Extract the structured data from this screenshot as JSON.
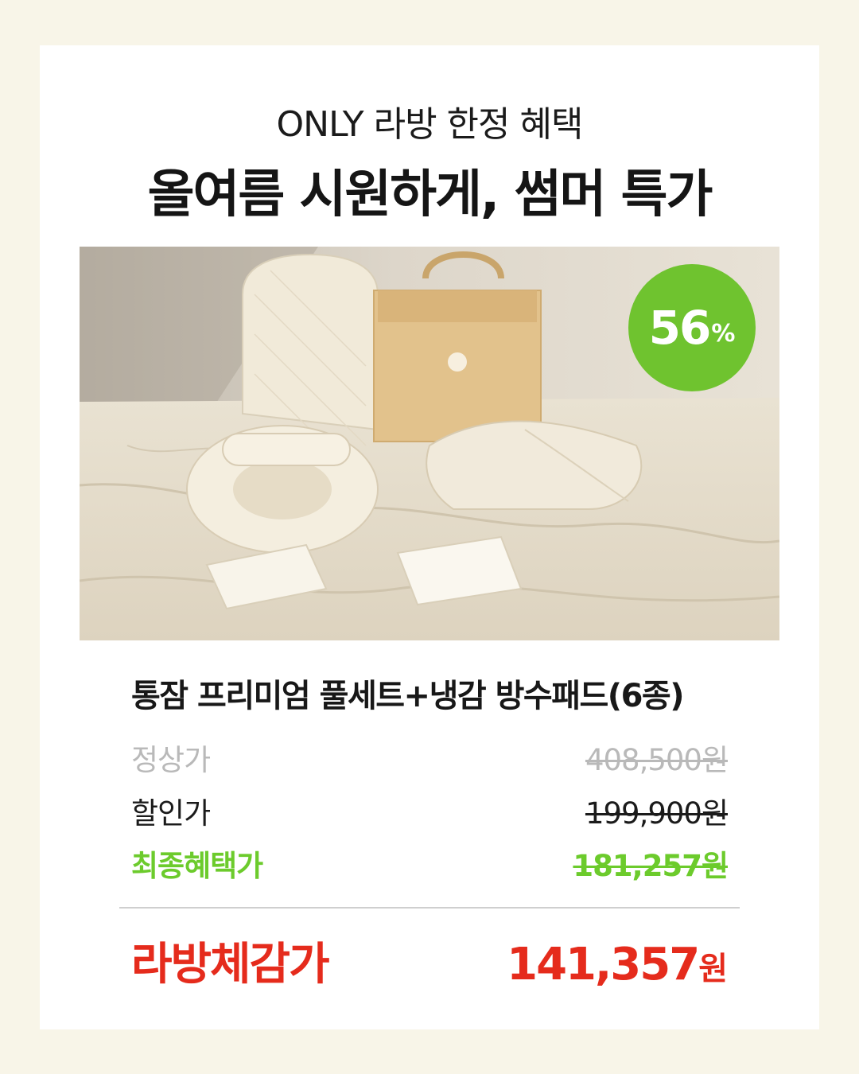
{
  "header": {
    "subtitle": "ONLY 라방 한정 혜택",
    "title": "올여름 시원하게, 썸머 특가"
  },
  "badge": {
    "number": "56",
    "unit": "%"
  },
  "product": {
    "name": "통잠 프리미엄 풀세트+냉감 방수패드(6종)"
  },
  "prices": {
    "regular": {
      "label": "정상가",
      "value": "408,500원"
    },
    "sale": {
      "label": "할인가",
      "value": "199,900원"
    },
    "final": {
      "label": "최종혜택가",
      "value": "181,257원"
    },
    "live": {
      "label": "라방체감가",
      "value": "141,357",
      "unit": "원"
    }
  },
  "colors": {
    "background": "#f8f5e8",
    "badge": "#6fc32f",
    "final_price": "#6ccb2c",
    "live_price": "#e52b1c"
  }
}
